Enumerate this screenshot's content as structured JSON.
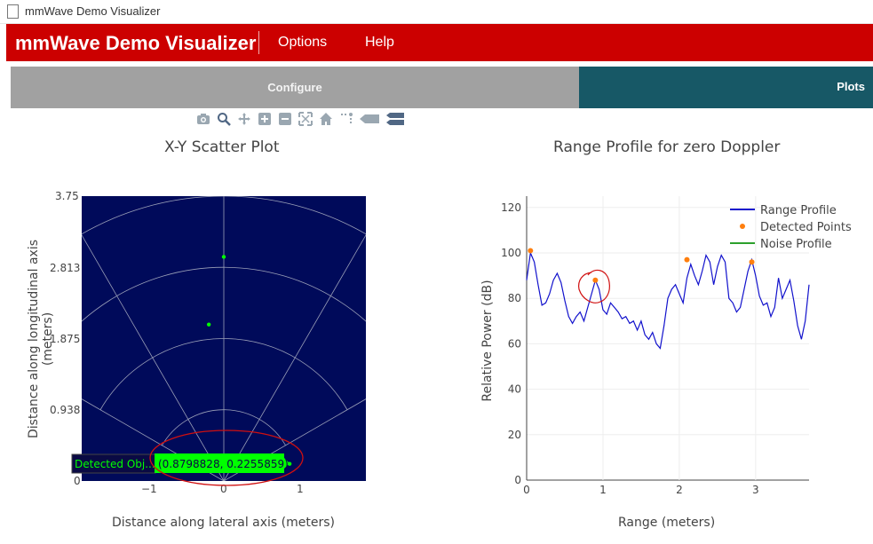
{
  "window": {
    "title": "mmWave Demo Visualizer"
  },
  "header": {
    "app_title": "mmWave Demo Visualizer",
    "menu": [
      "Options",
      "Help"
    ]
  },
  "tabs": [
    {
      "label": "Configure",
      "active": false
    },
    {
      "label": "Plots",
      "active": true
    }
  ],
  "modebar": [
    "camera-icon",
    "zoom-icon",
    "pan-icon",
    "zoom-in-icon",
    "zoom-out-icon",
    "autoscale-icon",
    "reset-axes-icon",
    "spike-lines-icon",
    "hover-closest-icon",
    "hover-compare-icon"
  ],
  "colors": {
    "header_red": "#cc0000",
    "tab_gray": "#a1a1a1",
    "tab_teal": "#175866",
    "scatter_bg": "#000a5a",
    "range_line": "#1111cc",
    "detected_orange": "#ff7f0e",
    "noise_green": "#2ca02c",
    "point_green": "#00ff00"
  },
  "chart_data": [
    {
      "type": "scatter",
      "title": "X-Y Scatter Plot",
      "xlabel": "Distance along lateral axis (meters)",
      "ylabel": "Distance along longitudinal axis (meters)",
      "xlim": [
        -1.9,
        1.9
      ],
      "ylim": [
        0,
        3.75
      ],
      "x_ticks": [
        "−1",
        "0",
        "1"
      ],
      "y_ticks": [
        "0",
        "0.938",
        "1.875",
        "2.813",
        "3.75"
      ],
      "background": "polar-grid",
      "points": [
        {
          "x": 0.0,
          "y": 2.95
        },
        {
          "x": -0.2,
          "y": 2.06
        },
        {
          "x": 0.88,
          "y": 0.226
        }
      ],
      "hover": {
        "label": "Detected Obj...",
        "value": "(0.8798828, 0.2255859)"
      }
    },
    {
      "type": "line",
      "title": "Range Profile for zero Doppler",
      "xlabel": "Range (meters)",
      "ylabel": "Relative Power (dB)",
      "xlim": [
        0,
        3.7
      ],
      "ylim": [
        0,
        125
      ],
      "x_ticks": [
        "0",
        "1",
        "2",
        "3"
      ],
      "y_ticks": [
        "0",
        "20",
        "40",
        "60",
        "80",
        "100",
        "120"
      ],
      "legend": [
        "Range Profile",
        "Detected Points",
        "Noise Profile"
      ],
      "legend_position": "top-right",
      "series": [
        {
          "name": "Range Profile",
          "x": [
            0,
            0.05,
            0.1,
            0.15,
            0.2,
            0.25,
            0.3,
            0.35,
            0.4,
            0.45,
            0.5,
            0.55,
            0.6,
            0.65,
            0.7,
            0.75,
            0.8,
            0.85,
            0.9,
            0.95,
            1.0,
            1.05,
            1.1,
            1.15,
            1.2,
            1.25,
            1.3,
            1.35,
            1.4,
            1.45,
            1.5,
            1.55,
            1.6,
            1.65,
            1.7,
            1.75,
            1.8,
            1.85,
            1.9,
            1.95,
            2.0,
            2.05,
            2.1,
            2.15,
            2.2,
            2.25,
            2.3,
            2.35,
            2.4,
            2.45,
            2.5,
            2.55,
            2.6,
            2.65,
            2.7,
            2.75,
            2.8,
            2.85,
            2.9,
            2.95,
            3.0,
            3.05,
            3.1,
            3.15,
            3.2,
            3.25,
            3.3,
            3.35,
            3.4,
            3.45,
            3.5,
            3.55,
            3.6,
            3.65,
            3.7
          ],
          "y": [
            88,
            100,
            96,
            86,
            77,
            78,
            82,
            88,
            91,
            87,
            79,
            72,
            69,
            72,
            74,
            70,
            76,
            82,
            88,
            84,
            75,
            73,
            78,
            76,
            74,
            71,
            72,
            69,
            70,
            66,
            70,
            64,
            62,
            65,
            60,
            58,
            68,
            80,
            84,
            86,
            82,
            78,
            89,
            95,
            90,
            86,
            92,
            99,
            96,
            86,
            94,
            99,
            96,
            80,
            78,
            74,
            76,
            84,
            92,
            97,
            90,
            81,
            77,
            78,
            72,
            76,
            89,
            80,
            84,
            88,
            79,
            68,
            62,
            70,
            86
          ]
        },
        {
          "name": "Detected Points",
          "x": [
            0.05,
            0.9,
            2.1,
            2.95
          ],
          "y": [
            101,
            88,
            97,
            96
          ]
        },
        {
          "name": "Noise Profile",
          "x": [],
          "y": []
        }
      ]
    }
  ]
}
